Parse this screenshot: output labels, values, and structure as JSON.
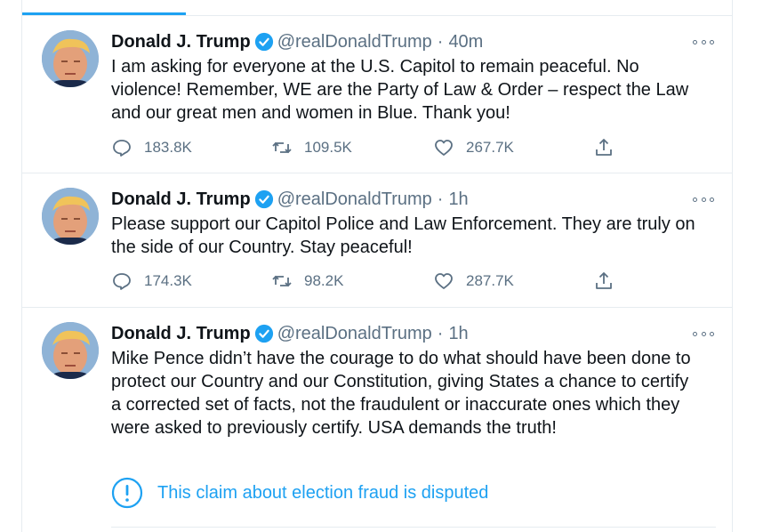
{
  "colors": {
    "accent": "#1da1f2",
    "secondary_text": "#5b7083",
    "border": "#e6ecf0"
  },
  "tweets": [
    {
      "name": "Donald J. Trump",
      "handle": "@realDonaldTrump",
      "separator": "·",
      "time": "40m",
      "text": "I am asking for everyone at the U.S. Capitol to remain peaceful. No violence! Remember, WE are the Party of Law & Order – respect the Law and our great men and women in Blue. Thank you!",
      "replies": "183.8K",
      "retweets": "109.5K",
      "likes": "267.7K"
    },
    {
      "name": "Donald J. Trump",
      "handle": "@realDonaldTrump",
      "separator": "·",
      "time": "1h",
      "text": "Please support our Capitol Police and Law Enforcement. They are truly on the side of our Country. Stay peaceful!",
      "replies": "174.3K",
      "retweets": "98.2K",
      "likes": "287.7K"
    },
    {
      "name": "Donald J. Trump",
      "handle": "@realDonaldTrump",
      "separator": "·",
      "time": "1h",
      "text": "Mike Pence didn’t have the courage to do what should have been done to protect our Country and our Constitution, giving States a chance to certify a corrected set of facts, not the fraudulent or inaccurate ones which they were asked to previously certify. USA demands the truth!",
      "notice": "This claim about election fraud is disputed"
    }
  ],
  "icons": {
    "verified": "verified-badge-icon",
    "more": "more-options-icon",
    "reply": "reply-icon",
    "retweet": "retweet-icon",
    "like": "heart-icon",
    "share": "share-icon",
    "notice": "exclamation-circle-icon"
  }
}
